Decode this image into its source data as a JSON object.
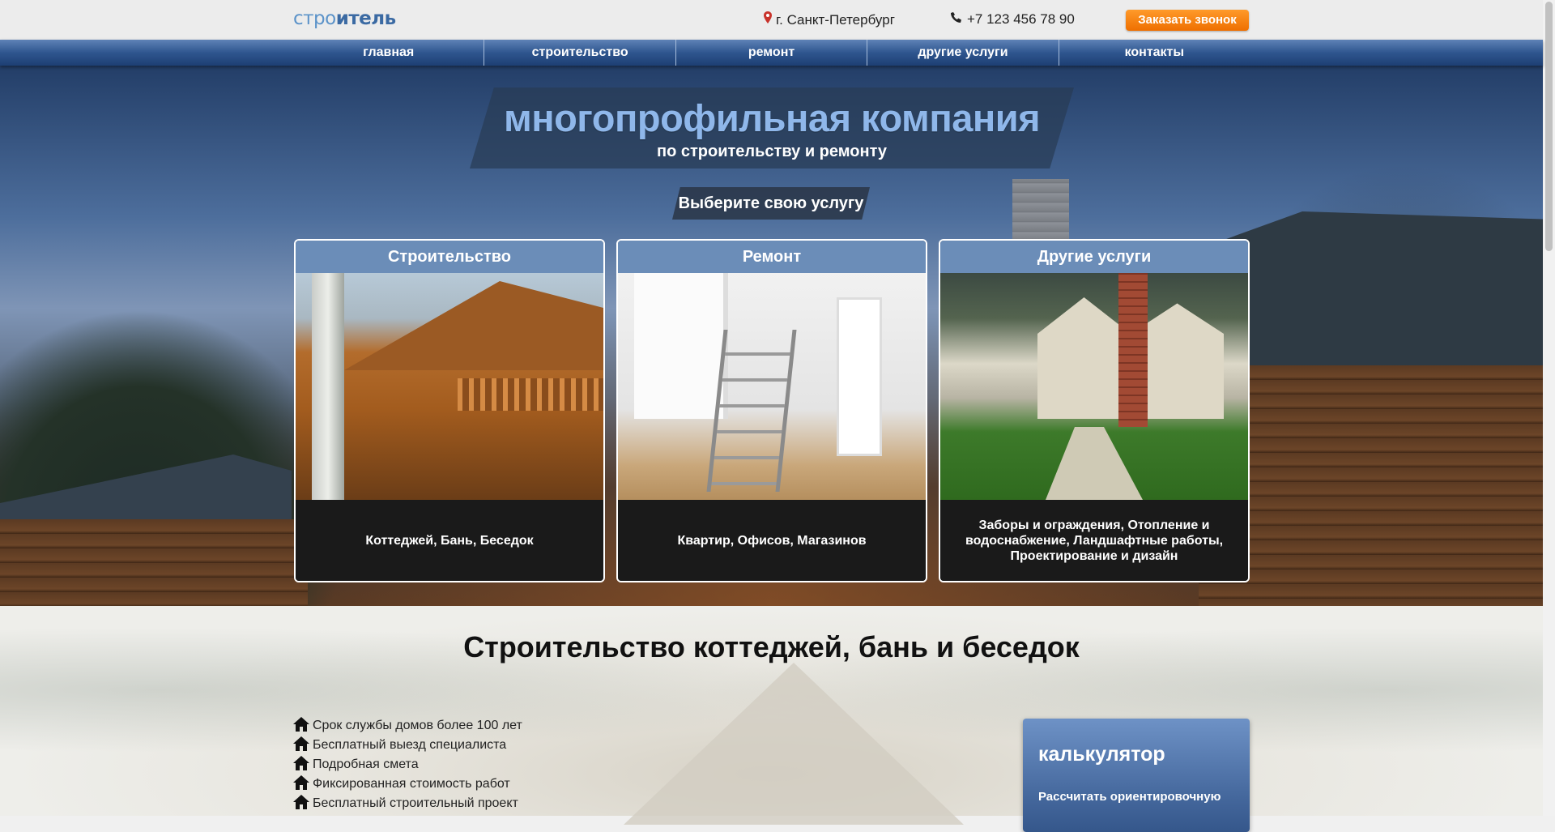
{
  "header": {
    "logo_part1": "стро",
    "logo_part2": "итель",
    "city": "г. Санкт-Петербург",
    "phone": "+7 123 456 78 90",
    "callback_button": "Заказать звонок"
  },
  "nav": {
    "items": [
      {
        "label": "главная"
      },
      {
        "label": "строительство"
      },
      {
        "label": "ремонт"
      },
      {
        "label": "другие услуги"
      },
      {
        "label": "контакты"
      }
    ]
  },
  "hero": {
    "title": "многопрофильная компания",
    "subtitle": "по строительству и ремонту",
    "choose_label": "Выберите свою услугу"
  },
  "services": [
    {
      "title": "Строительство",
      "caption": "Коттеджей, Бань, Беседок"
    },
    {
      "title": "Ремонт",
      "caption": "Квартир, Офисов, Магазинов"
    },
    {
      "title": "Другие услуги",
      "caption": "Заборы и ограждения, Отопление и водоснабжение, Ландшафтные работы, Проектирование и дизайн"
    }
  ],
  "section": {
    "title": "Строительство коттеджей, бань и беседок",
    "features": [
      "Срок службы домов более 100 лет",
      "Бесплатный выезд специалиста",
      "Подробная смета",
      "Фиксированная стоимость работ",
      "Бесплатный строительный проект"
    ]
  },
  "calculator": {
    "title": "калькулятор",
    "text": "Рассчитать ориентировочную"
  },
  "colors": {
    "brand_blue": "#3b6aa3",
    "nav_blue": "#2f568f",
    "accent_orange": "#ff8a14",
    "title_blue": "#8fb7ea"
  }
}
